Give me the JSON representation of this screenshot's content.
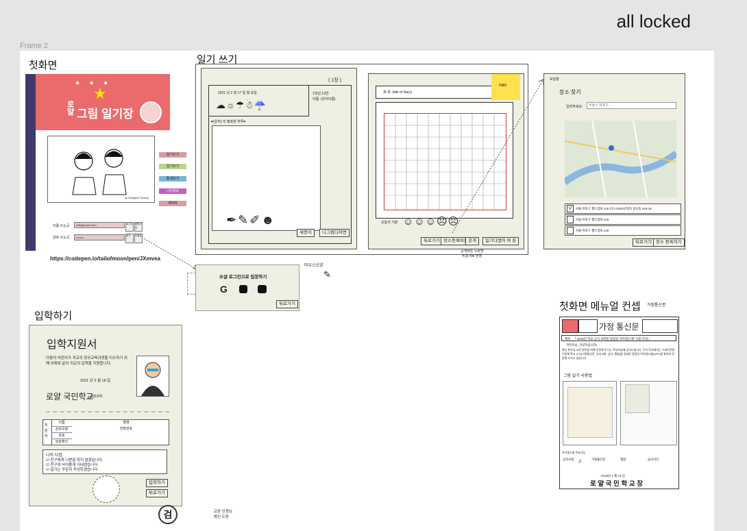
{
  "status": "all locked",
  "frame_label": "Frame 2",
  "sections": {
    "home": "첫화면",
    "diary": "일기 쓰기",
    "admission": "입학하기",
    "manual": "첫화면 메뉴얼 컨셉",
    "manual_sub": "가정통신문"
  },
  "home": {
    "title_prefix": "로\n얄",
    "title": "그림 일기장",
    "menu": [
      "일기쓰기",
      "일기보기",
      "통계보기",
      "나의정보",
      "계작자"
    ],
    "caption": "@ Designer Tommy",
    "id_label": "이름 쓰는곳",
    "id_value": "wds@naver.com",
    "pw_label": "암호 쓰는곳",
    "pw_value": "••••••••",
    "btn_a1": "로그인",
    "btn_a2": "회원가입",
    "btn_b1": "찾기",
    "btn_b2": "도움말",
    "link": "https://codepen.io/tailofmoon/pen/JXmvea"
  },
  "social": {
    "title": "쏘샬 로그인으로 입장하기",
    "back": "뒤로가기",
    "mouse_label": "마우스모양"
  },
  "diary": {
    "page": "( 1장 )",
    "date": "2021 년  2  월  17  일     월  요일",
    "grade": "1학년 12반",
    "name": "이름: (유저이름)",
    "subject": "♥(유저) 의 행복한 하루♥",
    "btn_save": "새종이",
    "btn_dl": "다그림다하면",
    "title_field": "제 목: (title of diary)",
    "nav": "nav",
    "mood_label": "오늘의 기분",
    "btn_back": "뒤로가기",
    "btn_place": "장소등록버튼",
    "btn_public": "공개",
    "btn_done": "일기다썼어 버 튼",
    "note": "공개버튼 누르면\n비공개로 변경"
  },
  "modal": {
    "header": "모달창",
    "title": "장소 찾기",
    "input_label": "입력하세요:",
    "placeholder": "서울시 마포구 ...",
    "results": [
      "서울 마포구 월드컵로 240  (우) 03932(지번) 성산동 529-16",
      "서울 마포구 월드컵로 240",
      "서울 마포구 월드컵로 240"
    ],
    "check_mark": "V",
    "btn_back": "뒤로가기",
    "btn_register": "장소 등록하기"
  },
  "admission": {
    "title": "입학지원서",
    "body": "다음의 어린이가 귀교의 정규교육과정을 이수하기 위해 아래와 같이 귀교의 입학을 지원합니다.",
    "date": "2021 년   2  월  18 일",
    "school": "로얄 국민학교",
    "suffix": "교장귀하",
    "side_label": "지\n원\n자",
    "rows": [
      [
        "이름",
        "별명"
      ],
      [
        "전자우편",
        "전화번호"
      ],
      [
        "암호",
        ""
      ],
      [
        "암호확인",
        ""
      ]
    ],
    "pledge_title": "나의 다짐:",
    "pledges": [
      "친구에게 나쁜말 하지 않겠습니다.",
      "친구와 사이좋게 지내겠습니다.",
      "일기는 꾸준히 작성하겠습니다."
    ],
    "btn_enter": "입학하기",
    "btn_back": "뒤로가기",
    "seal_text": "검",
    "stamp_note": "교장 선생님\n확인 도장"
  },
  "notice": {
    "title": "가정 통신문",
    "subject": "제목 : 「 2018년 학교 공식 모바일 알림장 '아이엠스쿨' 사용 안내 」",
    "greeting": "학부모님, 안녕하십니까!",
    "body": "항상 본교의 교육 발전을 위해 성원해 주시는 학부모님께 감사드립니다. 우리 학교에서는 스마트폰을 이용해 학교 소식(가정통신문, 공지사항, 급식, 앨범)을 휴대폰 알림장 아이엠스쿨(APP)을 통하여 전달해 드리고 있습니다.",
    "section": "그림 일기 사용법",
    "app_label": "아이엠스쿨 주요기능",
    "features": [
      "공지사항",
      "가정통신문",
      "앨범",
      "급식식단"
    ],
    "date": "2018년   2  월  23  일",
    "principal": "로 얄 국 민 학 교 장"
  },
  "colors": {
    "banner": "#eb6a6b",
    "sidebar": "#3f3a6b",
    "card": "#efefe3",
    "sticky": "#ffe14d",
    "grid_red": "#d33",
    "menu": [
      "#d99ea0",
      "#b9d58a",
      "#7ab6d9",
      "#c35fc0",
      "#d99ea0"
    ]
  }
}
